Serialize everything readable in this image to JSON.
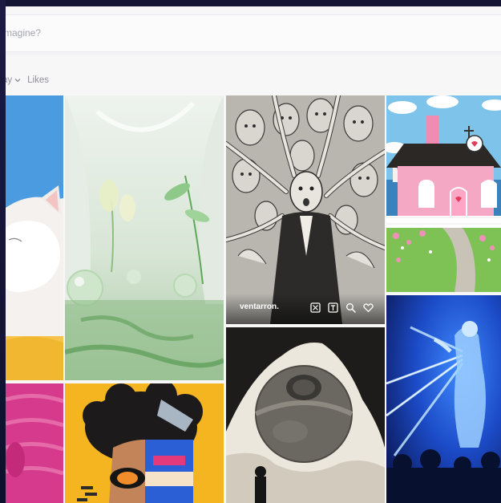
{
  "search": {
    "placeholder": "magine?"
  },
  "filters": {
    "sort_label": "ay",
    "likes_label": "Likes"
  },
  "gallery": {
    "featured_item": {
      "username": "ventarron.",
      "actions": [
        "remix-icon",
        "prompt-text-icon",
        "search-icon",
        "heart-icon"
      ]
    }
  },
  "colors": {
    "background": "#f7f7f8",
    "frame": "#16163a",
    "text_muted": "#8f8f9b"
  }
}
